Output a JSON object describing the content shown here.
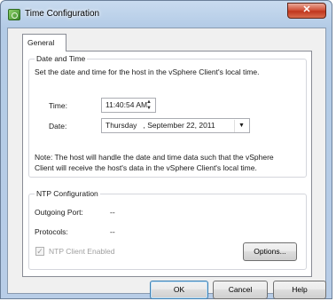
{
  "window": {
    "title": "Time Configuration",
    "close_glyph": "✕"
  },
  "tabs": [
    {
      "label": "General"
    }
  ],
  "date_time": {
    "group_title": "Date and Time",
    "description": "Set the date and time for the host in the vSphere Client's local time.",
    "time_label": "Time:",
    "time_value": "11:40:54 AM",
    "date_label": "Date:",
    "date_value": "Thursday   , September 22, 2011",
    "note_line1": "Note: The host will handle the date and time data such that the vSphere",
    "note_line2": "Client will receive the host's data in the vSphere Client's local time."
  },
  "ntp": {
    "group_title": "NTP Configuration",
    "outgoing_port_label": "Outgoing Port:",
    "outgoing_port_value": "--",
    "protocols_label": "Protocols:",
    "protocols_value": "--",
    "client_enabled_label": "NTP Client Enabled",
    "client_enabled_checked": true,
    "options_button": "Options..."
  },
  "footer": {
    "ok": "OK",
    "cancel": "Cancel",
    "help": "Help"
  },
  "icons": {
    "app": "vsphere-settings-icon",
    "spinner": "spinner-arrows-icon",
    "dropdown": "chevron-down-icon"
  }
}
